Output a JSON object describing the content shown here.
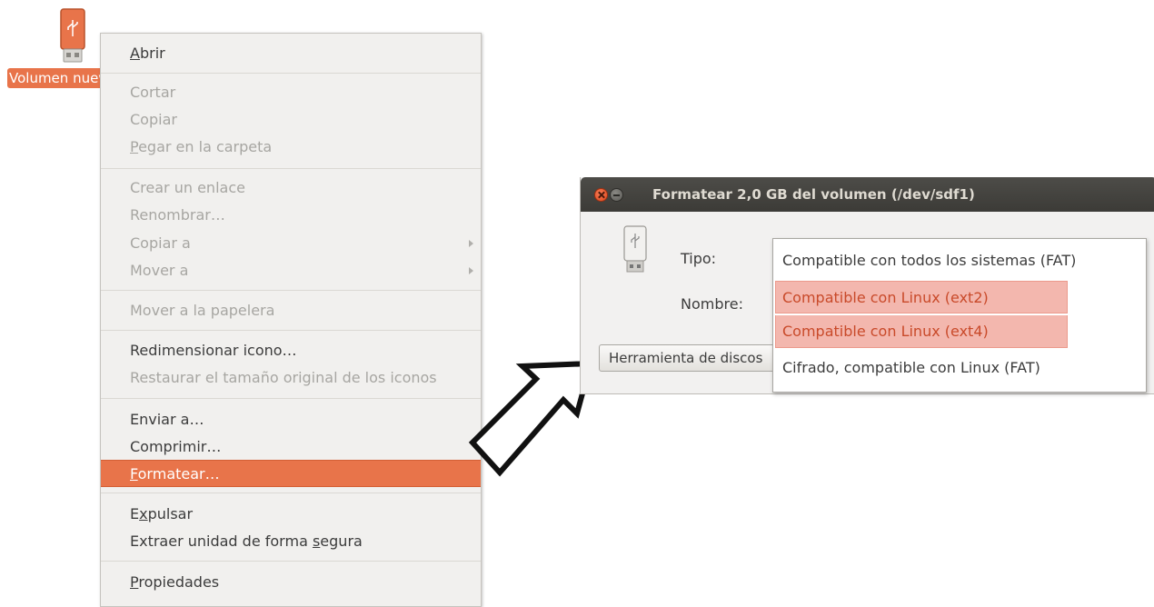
{
  "desktop": {
    "icon": "usb-drive-icon",
    "label": "Volumen nuevo"
  },
  "context_menu": {
    "items": [
      {
        "pre": "",
        "u": "A",
        "post": "brir",
        "enabled": true
      },
      {
        "pre": "Cortar",
        "u": "",
        "post": "",
        "enabled": false
      },
      {
        "pre": "Copiar",
        "u": "",
        "post": "",
        "enabled": false
      },
      {
        "pre": "",
        "u": "P",
        "post": "egar en la carpeta",
        "enabled": false
      },
      {
        "pre": "Crear un enlace",
        "u": "",
        "post": "",
        "enabled": false
      },
      {
        "pre": "Renombrar…",
        "u": "",
        "post": "",
        "enabled": false
      },
      {
        "pre": "Copiar a",
        "u": "",
        "post": "",
        "enabled": false,
        "submenu": true
      },
      {
        "pre": "Mover a",
        "u": "",
        "post": "",
        "enabled": false,
        "submenu": true
      },
      {
        "pre": "Mover a la papelera",
        "u": "",
        "post": "",
        "enabled": false
      },
      {
        "pre": "Redimensionar icono…",
        "u": "",
        "post": "",
        "enabled": true
      },
      {
        "pre": "Restaurar el tamaño original de los iconos",
        "u": "",
        "post": "",
        "enabled": false
      },
      {
        "pre": "Enviar a…",
        "u": "",
        "post": "",
        "enabled": true
      },
      {
        "pre": "Comprimir…",
        "u": "",
        "post": "",
        "enabled": true
      },
      {
        "pre": "",
        "u": "F",
        "post": "ormatear…",
        "enabled": true,
        "active": true
      },
      {
        "pre": "E",
        "u": "x",
        "post": "pulsar",
        "enabled": true
      },
      {
        "pre": "Extraer unidad de forma ",
        "u": "s",
        "post": "egura",
        "enabled": true
      },
      {
        "pre": "",
        "u": "P",
        "post": "ropiedades",
        "enabled": true
      }
    ],
    "active_color": "#e8744a"
  },
  "dialog": {
    "title": "Formatear 2,0 GB del volumen (/dev/sdf1)",
    "icon": "usb-drive-icon",
    "type_label": "Tipo:",
    "name_label": "Nombre:",
    "disk_tool_button": "Herramienta de discos",
    "type_options": [
      {
        "label": "Compatible con todos los sistemas (FAT)",
        "highlighted": false
      },
      {
        "label": "Compatible con Linux (ext2)",
        "highlighted": true
      },
      {
        "label": "Compatible con Linux (ext4)",
        "highlighted": true
      },
      {
        "label": "Cifrado, compatible con Linux (FAT)",
        "highlighted": false
      }
    ]
  },
  "arrow_icon": "pointer-arrow-icon"
}
